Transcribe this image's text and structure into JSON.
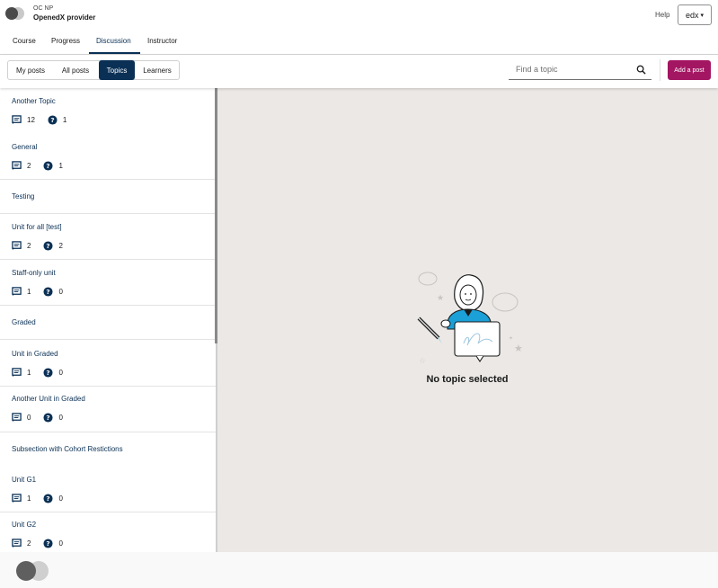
{
  "header": {
    "course_org": "OC NP",
    "course_title": "OpenedX provider",
    "help_label": "Help",
    "user_label": "edx"
  },
  "course_tabs": [
    {
      "label": "Course"
    },
    {
      "label": "Progress"
    },
    {
      "label": "Discussion",
      "active": true
    },
    {
      "label": "Instructor"
    }
  ],
  "discussion_nav": {
    "tabs": [
      {
        "label": "My posts"
      },
      {
        "label": "All posts"
      },
      {
        "label": "Topics",
        "active": true
      },
      {
        "label": "Learners"
      }
    ],
    "search_placeholder": "Find a topic",
    "add_post_label": "Add a post"
  },
  "topics": [
    {
      "title": "Another Topic",
      "posts": "12",
      "questions": "1"
    },
    {
      "title": "General",
      "posts": "2",
      "questions": "1"
    },
    {
      "title": "Testing"
    },
    {
      "title": "Unit for all [test]",
      "posts": "2",
      "questions": "2"
    },
    {
      "title": "Staff-only unit",
      "posts": "1",
      "questions": "0"
    },
    {
      "title": "Graded"
    },
    {
      "title": "Unit in Graded",
      "posts": "1",
      "questions": "0"
    },
    {
      "title": "Another Unit in Graded",
      "posts": "0",
      "questions": "0"
    },
    {
      "title": "Subsection with Cohort Restictions"
    },
    {
      "title": "Unit G1",
      "posts": "1",
      "questions": "0"
    },
    {
      "title": "Unit G2",
      "posts": "2",
      "questions": "0"
    }
  ],
  "main": {
    "empty_message": "No topic selected"
  },
  "colors": {
    "primary": "#0a3055",
    "brand": "#a31662"
  }
}
